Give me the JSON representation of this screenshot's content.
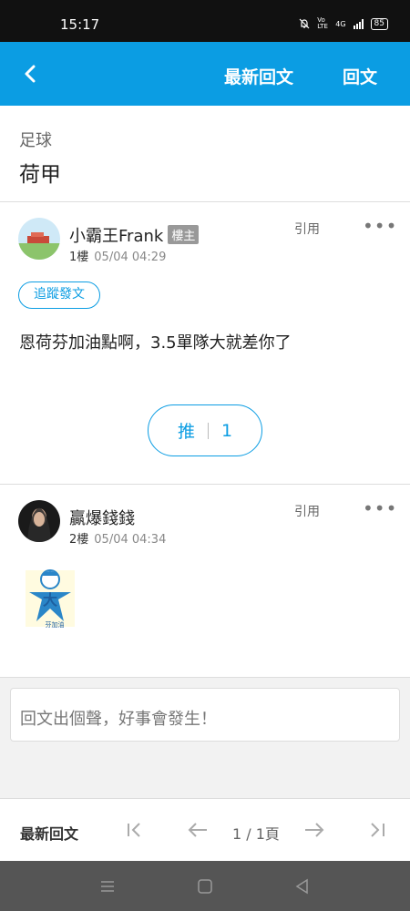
{
  "status_bar": {
    "time": "15:17",
    "network": "4G",
    "volte": "Vo LTE",
    "battery": "85"
  },
  "app_bar": {
    "latest_label": "最新回文",
    "reply_label": "回文"
  },
  "board": {
    "category": "足球",
    "title": "荷甲"
  },
  "posts": [
    {
      "author": "小霸王Frank",
      "badge": "樓主",
      "floor": "1樓",
      "time": "05/04 04:29",
      "quote_label": "引用",
      "more_label": "•••",
      "follow_label": "追蹤發文",
      "content": "恩荷芬加油點啊，3.5單隊大就差你了",
      "push_label": "推",
      "push_count": "1"
    },
    {
      "author": "贏爆錢錢",
      "floor": "2樓",
      "time": "05/04 04:34",
      "quote_label": "引用",
      "more_label": "•••",
      "sticker_text": "芬加油"
    }
  ],
  "reply": {
    "placeholder": "回文出個聲，好事會發生！"
  },
  "pager": {
    "latest_label": "最新回文",
    "page_text": "1 / 1頁"
  },
  "colors": {
    "accent": "#0b9de3",
    "status_bar": "#111111",
    "nav_bar": "#555555"
  }
}
